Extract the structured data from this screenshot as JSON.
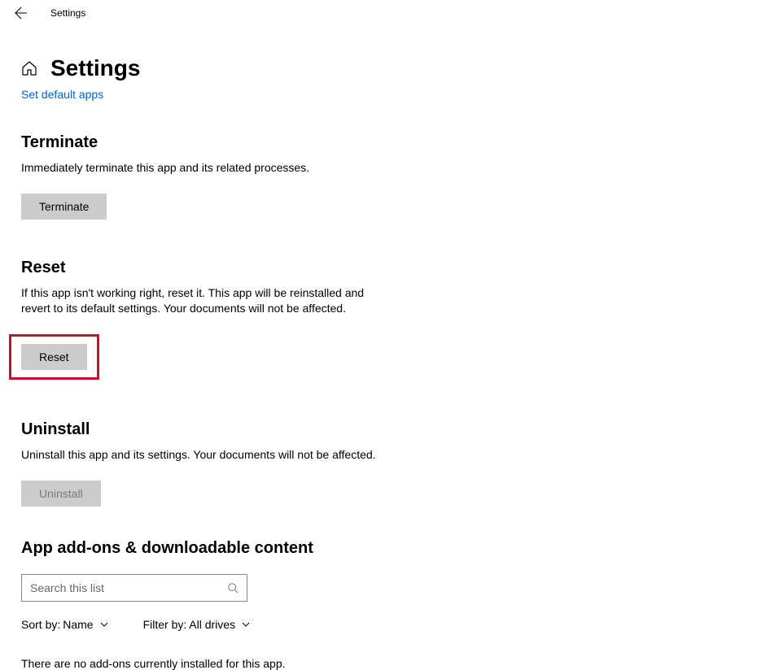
{
  "titlebar": {
    "title": "Settings"
  },
  "page": {
    "title": "Settings",
    "link": "Set default apps"
  },
  "terminate": {
    "title": "Terminate",
    "desc": "Immediately terminate this app and its related processes.",
    "button": "Terminate"
  },
  "reset": {
    "title": "Reset",
    "desc": "If this app isn't working right, reset it. This app will be reinstalled and revert to its default settings. Your documents will not be affected.",
    "button": "Reset"
  },
  "uninstall": {
    "title": "Uninstall",
    "desc": "Uninstall this app and its settings. Your documents will not be affected.",
    "button": "Uninstall"
  },
  "addons": {
    "title": "App add-ons & downloadable content",
    "search_placeholder": "Search this list",
    "sort_label": "Sort by: ",
    "sort_value": "Name",
    "filter_label": "Filter by: ",
    "filter_value": "All drives",
    "empty": "There are no add-ons currently installed for this app."
  }
}
